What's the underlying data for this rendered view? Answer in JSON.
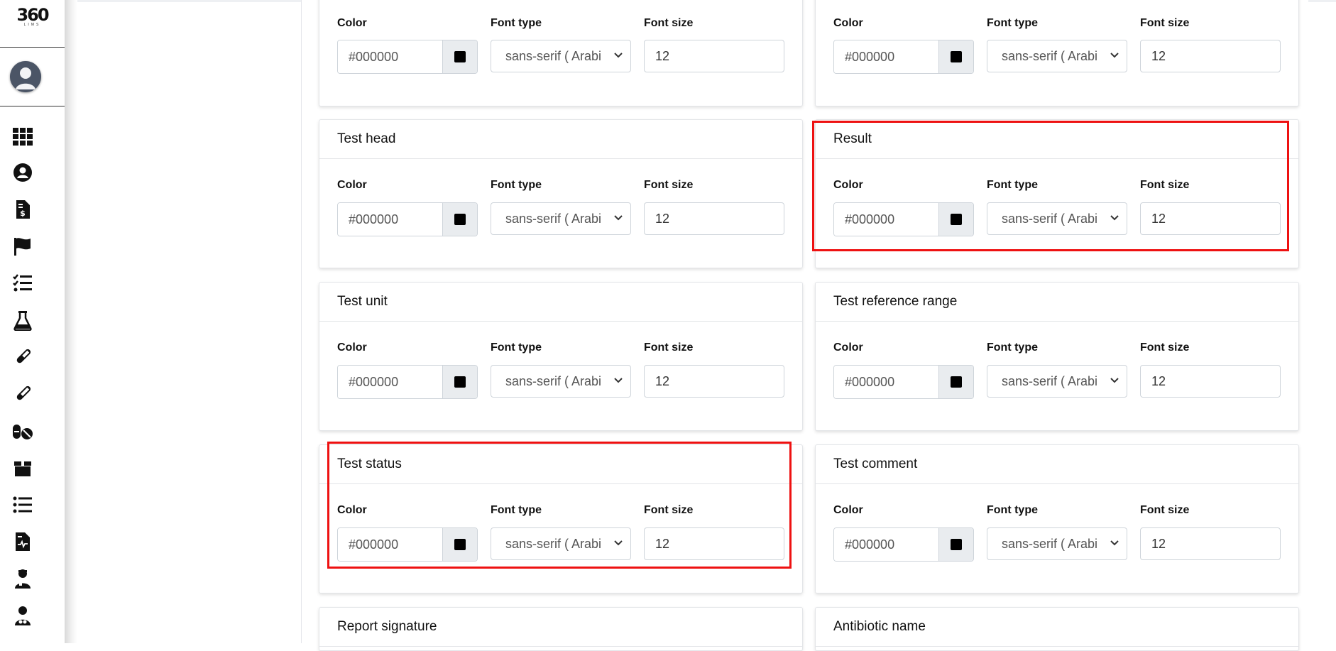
{
  "app": {
    "logo_text": "360",
    "logo_sub": "LIMS"
  },
  "sidebar": {
    "icons": [
      "dashboard-grid-icon",
      "patient-user-icon",
      "invoice-dollar-icon",
      "flag-icon",
      "task-list-icon",
      "flask-icon",
      "test-tube-icon",
      "sample-tube-icon",
      "pills-icon",
      "package-box-icon",
      "list-icon",
      "report-file-icon",
      "doctor-icon",
      "staff-icon"
    ]
  },
  "labels": {
    "color": "Color",
    "font_type": "Font type",
    "font_size": "Font size"
  },
  "cards": [
    {
      "title": "",
      "color": "#000000",
      "font_type": "sans-serif ( Arabi",
      "font_size": "12"
    },
    {
      "title": "",
      "color": "#000000",
      "font_type": "sans-serif ( Arabi",
      "font_size": "12"
    },
    {
      "title": "Test head",
      "color": "#000000",
      "font_type": "sans-serif ( Arabi",
      "font_size": "12"
    },
    {
      "title": "Result",
      "color": "#000000",
      "font_type": "sans-serif ( Arabi",
      "font_size": "12"
    },
    {
      "title": "Test unit",
      "color": "#000000",
      "font_type": "sans-serif ( Arabi",
      "font_size": "12"
    },
    {
      "title": "Test reference range",
      "color": "#000000",
      "font_type": "sans-serif ( Arabi",
      "font_size": "12"
    },
    {
      "title": "Test status",
      "color": "#000000",
      "font_type": "sans-serif ( Arabi",
      "font_size": "12"
    },
    {
      "title": "Test comment",
      "color": "#000000",
      "font_type": "sans-serif ( Arabi",
      "font_size": "12"
    },
    {
      "title": "Report signature"
    },
    {
      "title": "Antibiotic name"
    }
  ],
  "colors": {
    "highlight": "#ee1111",
    "swatch": "#000000"
  }
}
